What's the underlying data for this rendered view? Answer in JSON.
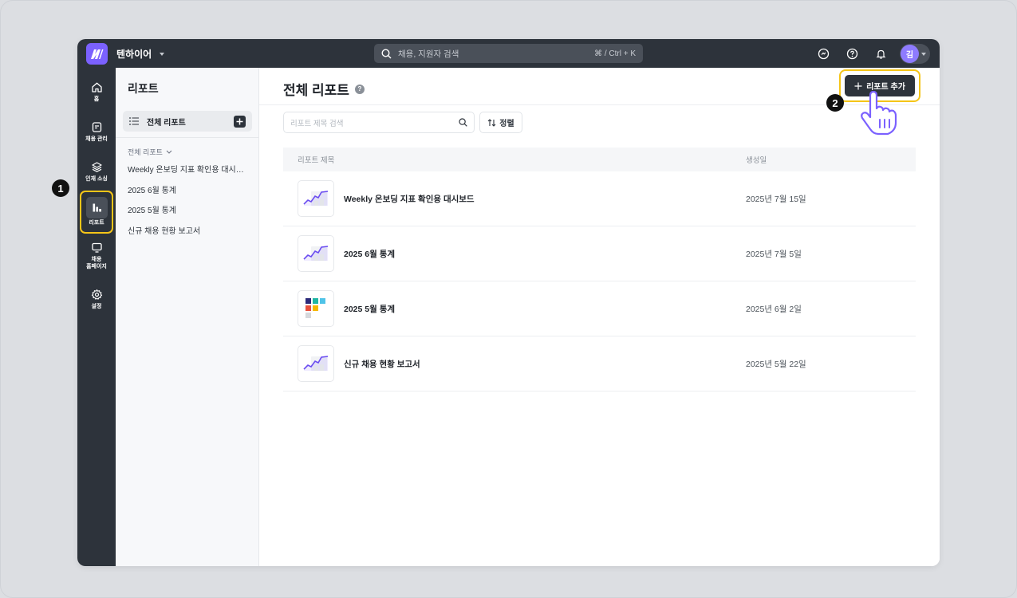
{
  "topbar": {
    "workspace": "텐하이어",
    "search_placeholder": "채용, 지원자 검색",
    "search_shortcut": "⌘ / Ctrl + K",
    "avatar_initial": "김"
  },
  "rail": {
    "items": [
      {
        "label": "홈",
        "icon": "home-icon"
      },
      {
        "label": "채용 관리",
        "icon": "clipboard-icon"
      },
      {
        "label": "인재 소싱",
        "icon": "layers-icon"
      },
      {
        "label": "리포트",
        "icon": "bar-chart-icon"
      },
      {
        "label": "채용\n홈페이지",
        "icon": "monitor-icon"
      },
      {
        "label": "설정",
        "icon": "gear-icon"
      }
    ]
  },
  "sidebar": {
    "title": "리포트",
    "all_reports": "전체 리포트",
    "section_label": "전체 리포트",
    "links": [
      "Weekly 온보딩 지표 확인용 대시보드",
      "2025 6월 통계",
      "2025 5월 통계",
      "신규 채용 현황 보고서"
    ]
  },
  "main": {
    "title": "전체 리포트",
    "add_button": "리포트 추가",
    "search_placeholder": "리포트 제목 검색",
    "sort_label": "정렬",
    "columns": [
      "리포트 제목",
      "생성일"
    ],
    "rows": [
      {
        "title": "Weekly 온보딩 지표 확인용 대시보드",
        "date": "2025년 7월 15일",
        "thumb": "line"
      },
      {
        "title": "2025 6월 통계",
        "date": "2025년 7월 5일",
        "thumb": "line"
      },
      {
        "title": "2025 5월 통계",
        "date": "2025년 6월 2일",
        "thumb": "blocks"
      },
      {
        "title": "신규 채용 현황 보고서",
        "date": "2025년 5월 22일",
        "thumb": "line"
      }
    ]
  },
  "callouts": {
    "one": "1",
    "two": "2"
  },
  "colors": {
    "accent": "#7b61ff",
    "highlight": "#f5c518",
    "dark": "#2d333b"
  }
}
